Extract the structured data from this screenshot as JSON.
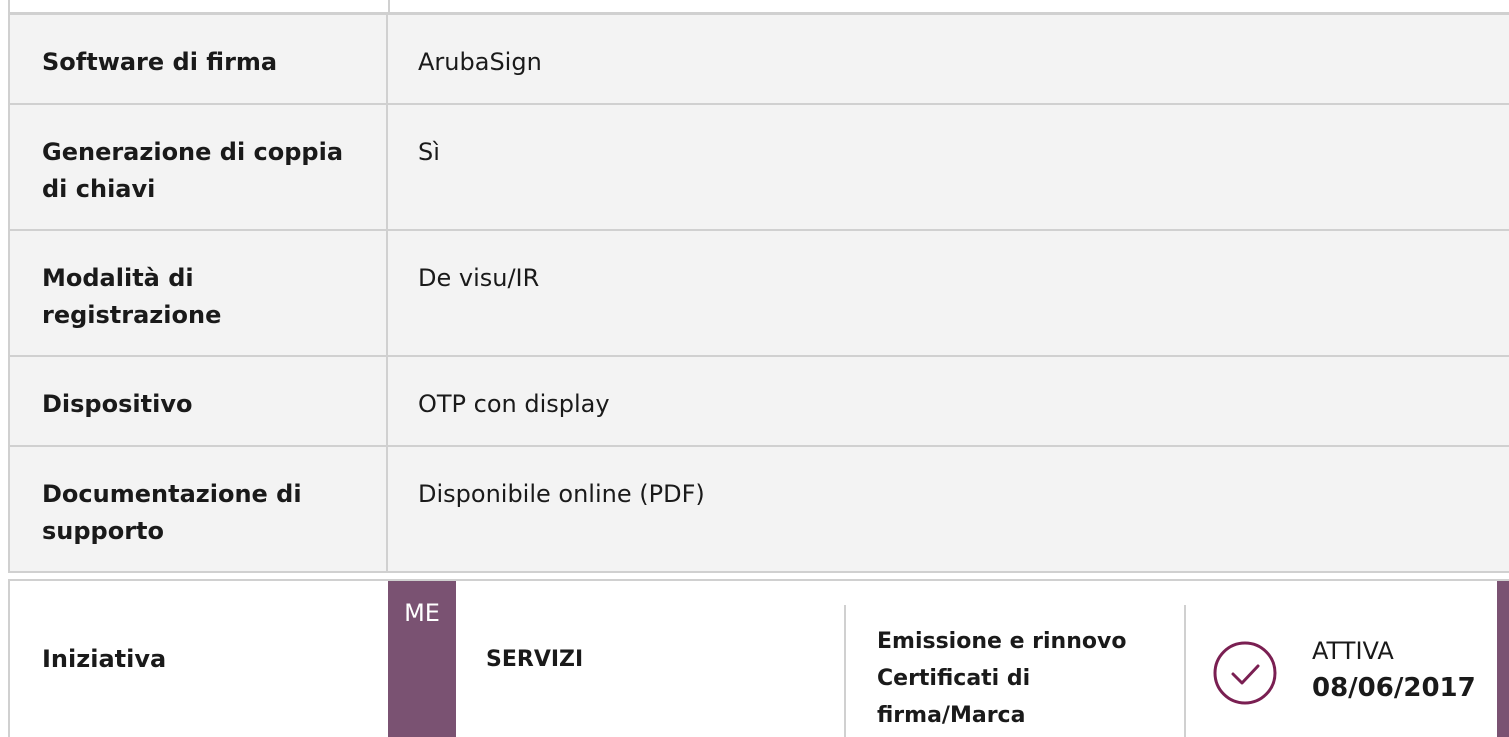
{
  "rows": [
    {
      "label": "Software di firma",
      "value": "ArubaSign"
    },
    {
      "label": "Generazione di coppia di chiavi",
      "value": "Sì"
    },
    {
      "label": "Modalità di registrazione",
      "value": "De visu/IR"
    },
    {
      "label": "Dispositivo",
      "value": "OTP con display"
    },
    {
      "label": "Documentazione di supporto",
      "value": "Disponibile online (PDF)"
    }
  ],
  "iniziativa": {
    "label": "Iniziativa",
    "badge": "ME",
    "category": "SERVIZI",
    "description_lines": [
      "Emissione e rinnovo",
      "Certificati di",
      "firma/Marca"
    ],
    "status": "ATTIVA",
    "date": "08/06/2017",
    "icon": "check-circle-icon",
    "accent_color": "#7a5272"
  }
}
